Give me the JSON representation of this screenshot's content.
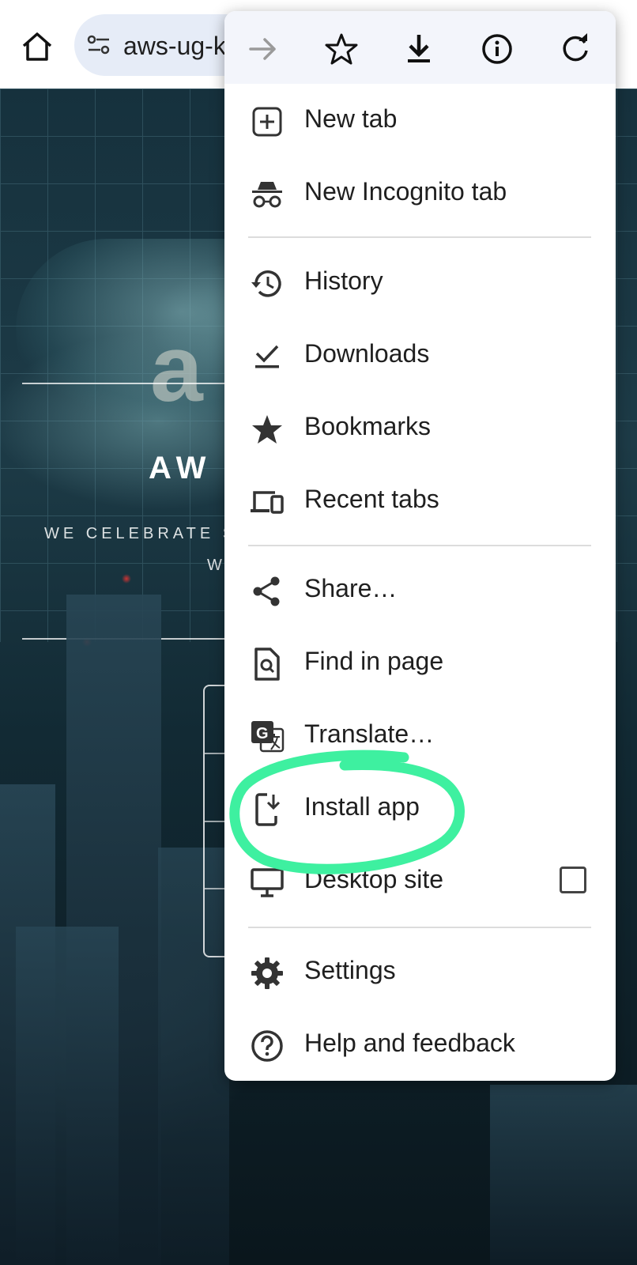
{
  "browser": {
    "url_text": "aws-ug-k",
    "toolbar_icons": [
      "home-icon",
      "site-settings-icon",
      "forward-arrow-icon",
      "star-icon",
      "download-icon",
      "info-icon",
      "reload-icon"
    ]
  },
  "page": {
    "cloud_logo_text": "a",
    "hero_title": "AW",
    "tagline_line1": "WE CELEBRATE S",
    "tagline_line2": "W"
  },
  "menu": {
    "items": [
      {
        "label": "New tab",
        "icon": "new-tab-icon"
      },
      {
        "label": "New Incognito tab",
        "icon": "incognito-icon"
      },
      {
        "label": "History",
        "icon": "history-icon"
      },
      {
        "label": "Downloads",
        "icon": "downloads-icon"
      },
      {
        "label": "Bookmarks",
        "icon": "bookmarks-star-icon"
      },
      {
        "label": "Recent tabs",
        "icon": "recent-tabs-icon"
      },
      {
        "label": "Share…",
        "icon": "share-icon"
      },
      {
        "label": "Find in page",
        "icon": "find-in-page-icon"
      },
      {
        "label": "Translate…",
        "icon": "translate-icon"
      },
      {
        "label": "Install app",
        "icon": "install-app-icon"
      },
      {
        "label": "Desktop site",
        "icon": "desktop-site-icon",
        "checked": false
      },
      {
        "label": "Settings",
        "icon": "settings-gear-icon"
      },
      {
        "label": "Help and feedback",
        "icon": "help-icon"
      }
    ]
  },
  "annotation": {
    "highlight_color": "#3ef0a0",
    "highlighted_item": "Install app"
  }
}
